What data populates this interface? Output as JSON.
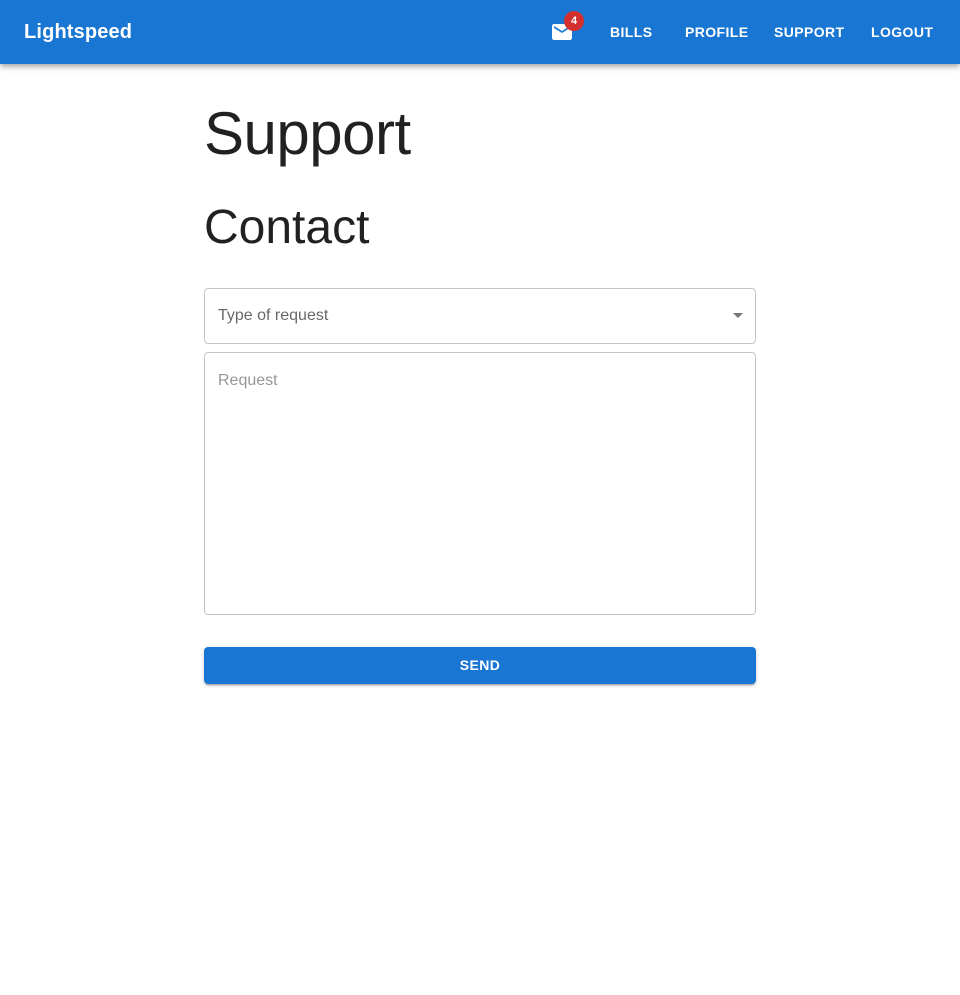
{
  "app_bar": {
    "brand": "Lightspeed",
    "mail_icon": "mail-icon",
    "mail_badge_count": "4",
    "nav": {
      "bills": "BILLS",
      "profile": "PROFILE",
      "support": "SUPPORT",
      "logout": "LOGOUT"
    }
  },
  "page": {
    "title": "Support",
    "section_title": "Contact"
  },
  "form": {
    "type_of_request": {
      "label": "Type of request",
      "value": "",
      "icon": "arrow-drop-down-icon"
    },
    "request": {
      "placeholder": "Request",
      "value": ""
    },
    "send_label": "SEND"
  },
  "colors": {
    "primary": "#1976d2",
    "badge": "#d32f2f",
    "background": "#ffffff"
  }
}
